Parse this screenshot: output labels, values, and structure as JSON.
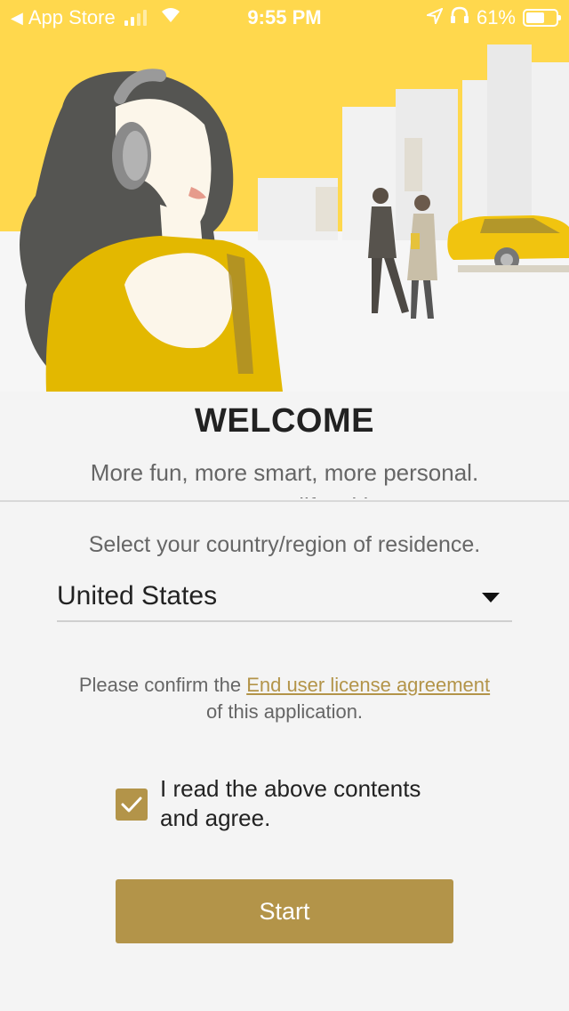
{
  "status_bar": {
    "back_label": "App Store",
    "time": "9:55 PM",
    "battery": "61%",
    "battery_level": 0.61
  },
  "welcome": {
    "title": "WELCOME",
    "subtitle_line1": "More fun, more smart, more personal.",
    "subtitle_line2": "Let's start your new life with your new"
  },
  "country": {
    "prompt": "Select your country/region of residence.",
    "selected": "United States"
  },
  "eula": {
    "prefix": "Please confirm the ",
    "link": "End user license agreement",
    "suffix": "of this application."
  },
  "agree": {
    "checked": true,
    "line1": "I read the above contents",
    "line2": "and agree."
  },
  "start_button": "Start",
  "colors": {
    "accent": "#b39449",
    "hero_yellow": "#ffd84d",
    "background": "#f4f4f4"
  }
}
